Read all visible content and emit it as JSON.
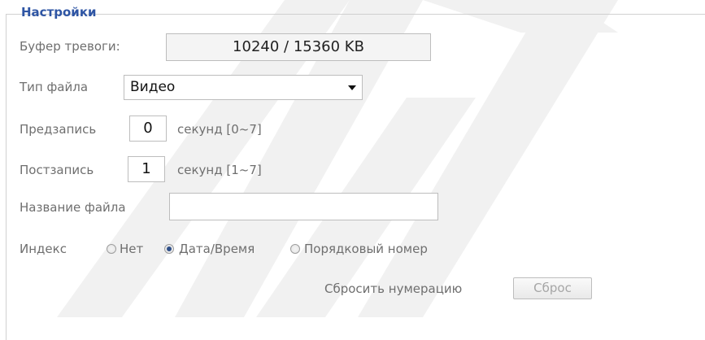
{
  "fieldset": {
    "legend": "Настройки"
  },
  "alarm_buffer": {
    "label": "Буфер тревоги:",
    "value": "10240 / 15360 KB"
  },
  "file_type": {
    "label": "Тип файла",
    "selected": "Видео"
  },
  "prerecord": {
    "label": "Предзапись",
    "value": "0",
    "unit": "секунд [0~7]"
  },
  "postrecord": {
    "label": "Постзапись",
    "value": "1",
    "unit": "секунд [1~7]"
  },
  "file_name": {
    "label": "Название файла",
    "value": ""
  },
  "index": {
    "label": "Индекс",
    "options": [
      {
        "label": "Нет",
        "checked": false
      },
      {
        "label": "Дата/Время",
        "checked": true
      },
      {
        "label": "Порядковый номер",
        "checked": false
      }
    ]
  },
  "reset_numbering": {
    "label": "Сбросить нумерацию",
    "button": "Сброс"
  },
  "colors": {
    "legend": "#2e55a4",
    "label": "#6f6f6f",
    "watermark": "#f0f0f0"
  }
}
